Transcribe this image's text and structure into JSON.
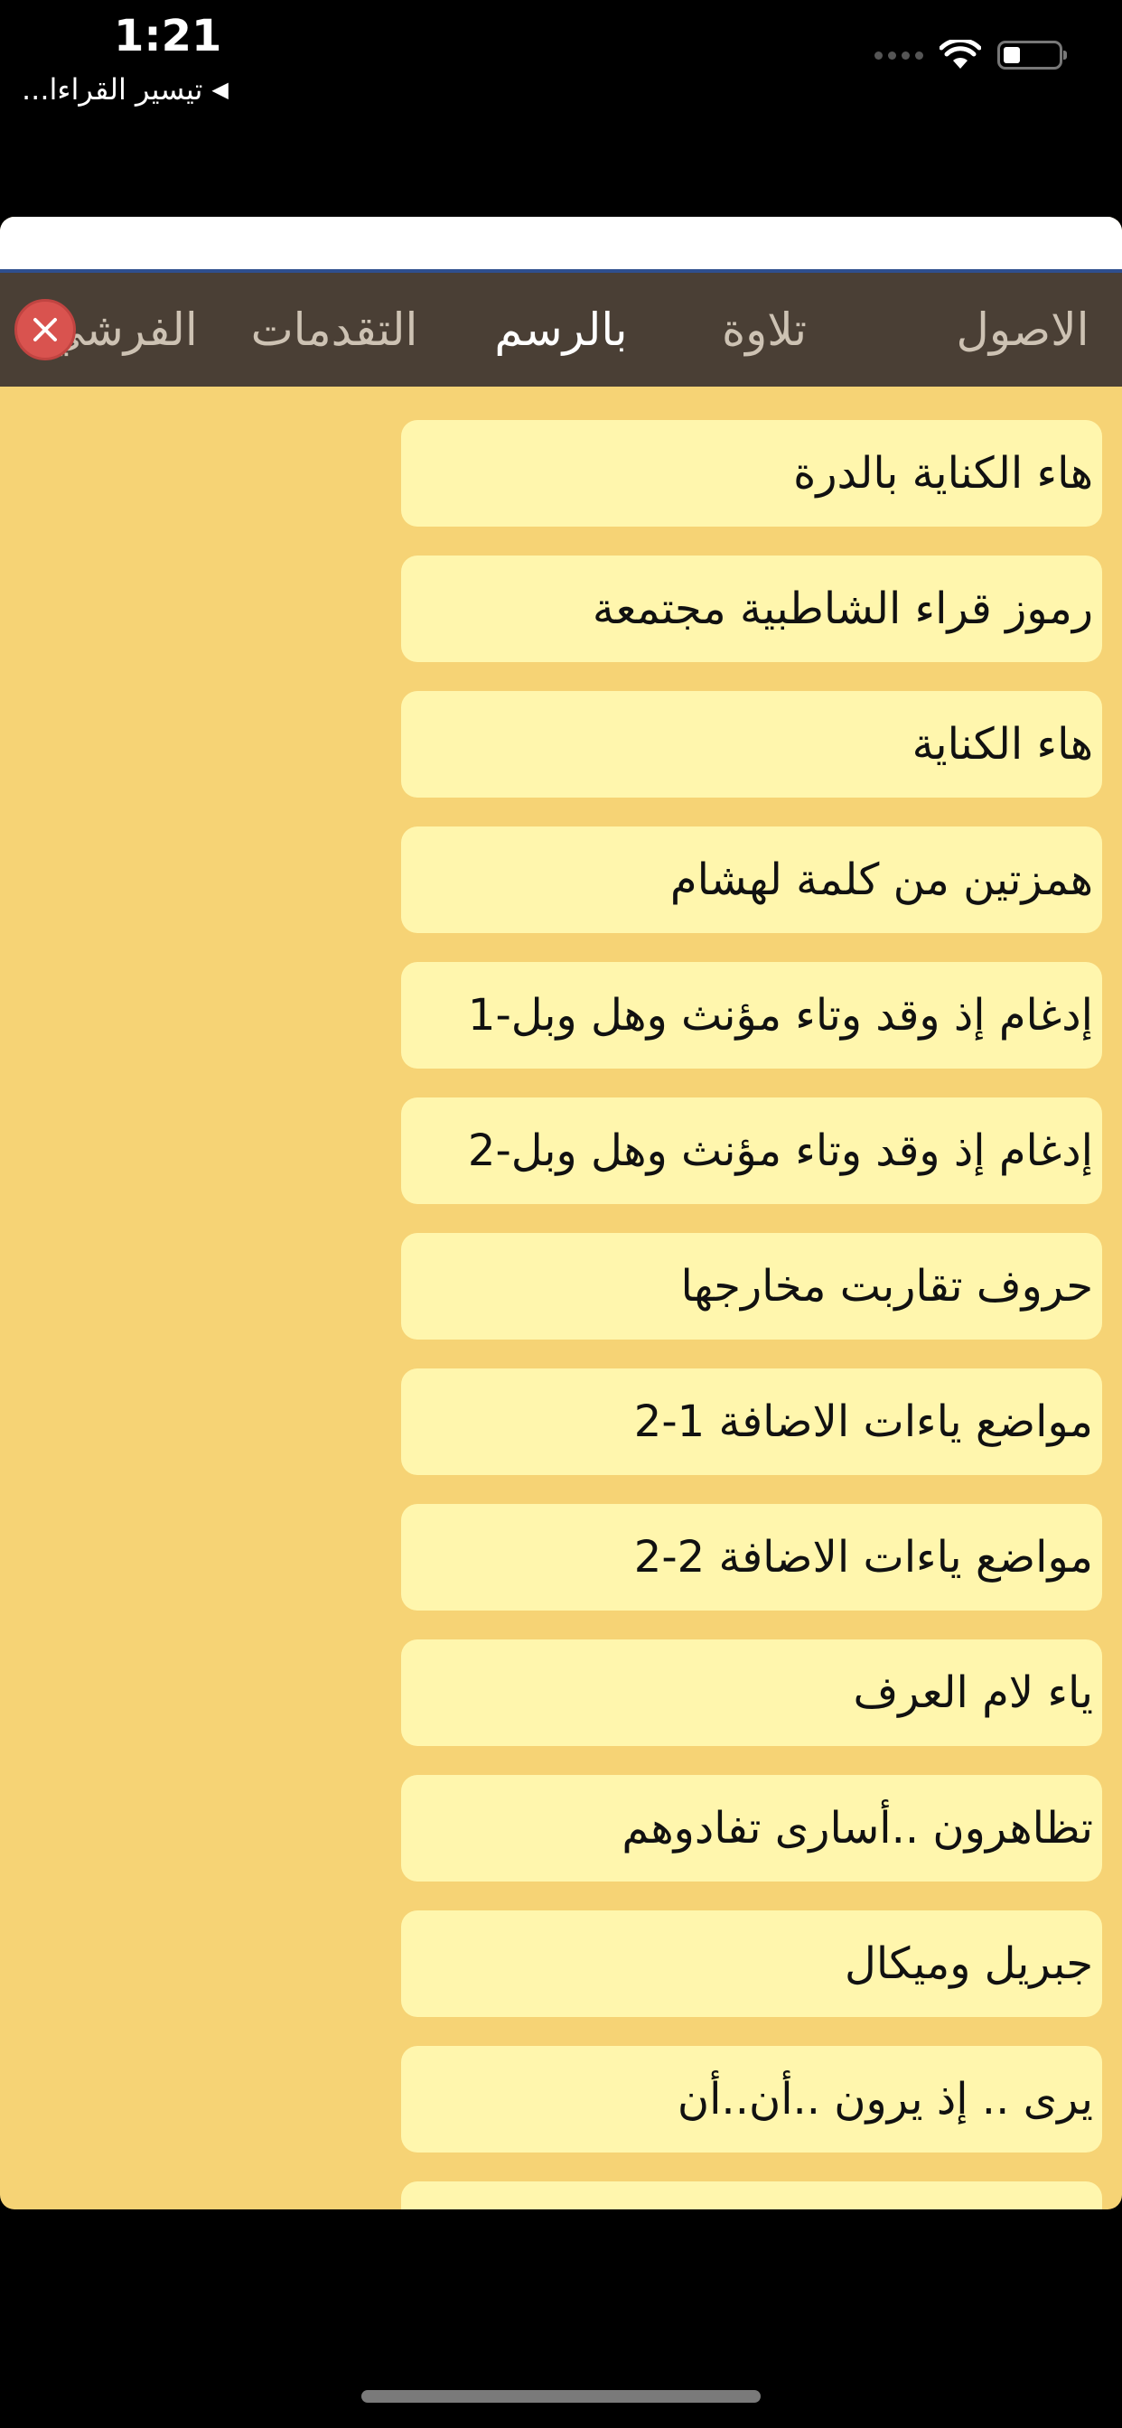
{
  "status_bar": {
    "time": "1:21",
    "back_app_label": "تيسير القراءا...",
    "back_arrow": "◀"
  },
  "tabs": [
    {
      "label": "الاصول",
      "active": false
    },
    {
      "label": "تلاوة",
      "active": false
    },
    {
      "label": "بالرسم",
      "active": true
    },
    {
      "label": "التقدمات",
      "active": false
    },
    {
      "label": "الفرشي",
      "active": false
    }
  ],
  "close_icon": "close-icon",
  "items": [
    "هاء الكناية بالدرة",
    "رموز قراء الشاطبية مجتمعة",
    "هاء الكناية",
    "همزتين من كلمة لهشام",
    "إدغام إذ وقد وتاء مؤنث وهل وبل-1",
    "إدغام إذ وقد وتاء مؤنث وهل وبل-2",
    "حروف تقاربت مخارجها",
    "مواضع ياءات الاضافة 1-2",
    "مواضع ياءات الاضافة 2-2",
    "ياء لام العرف",
    "تظاهرون ..أسارى تفادوهم",
    "جبريل وميكال",
    "يرى .. إذ يرون ..أن..أن",
    ""
  ],
  "colors": {
    "panel_bg": "#f6d375",
    "item_bg": "#fff6ad",
    "tabbar_bg": "#4a3f35",
    "close_red": "#d9534f"
  }
}
